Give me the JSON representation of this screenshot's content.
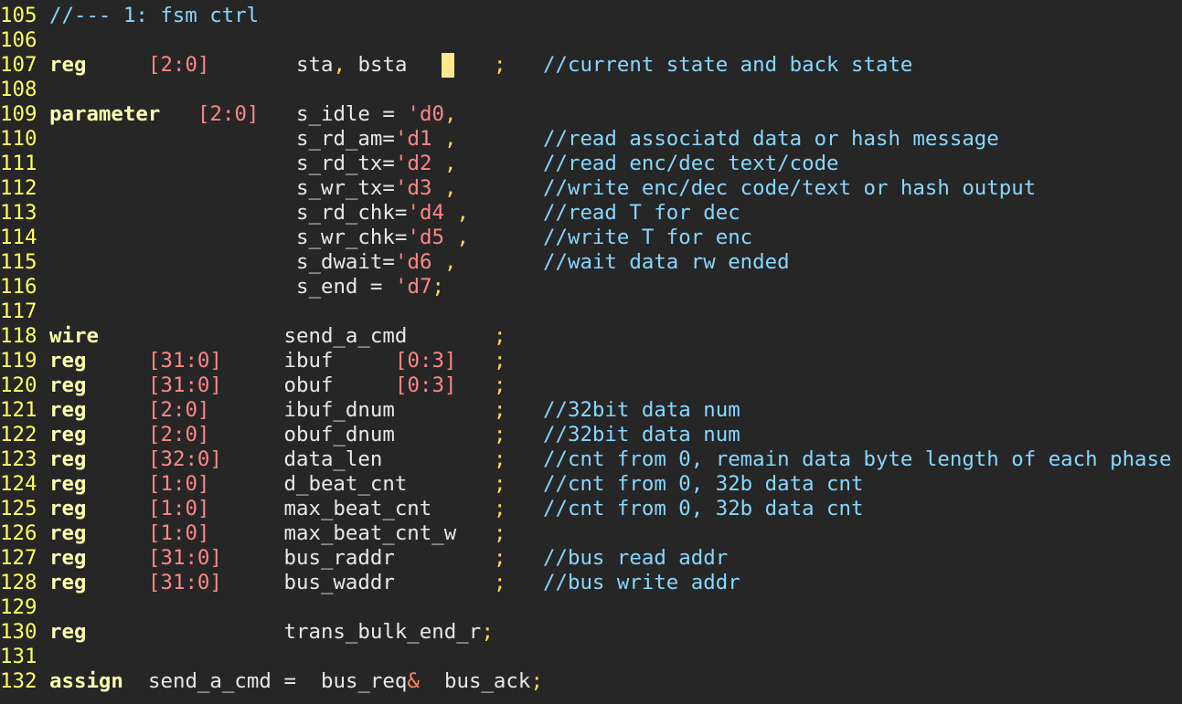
{
  "lines": [
    {
      "n": "105",
      "tokens": [
        {
          "cls": "cm",
          "text": "//--- 1: fsm ctrl"
        }
      ]
    },
    {
      "n": "106",
      "tokens": []
    },
    {
      "n": "107",
      "tokens": [
        {
          "cls": "kw",
          "text": "reg"
        },
        {
          "cls": "num",
          "text": "[2:0]"
        },
        {
          "cls": "id",
          "text": "sta"
        },
        {
          "cls": "pun",
          "text": ","
        },
        {
          "cls": "id",
          "text": "bsta"
        },
        {
          "cls": "pun",
          "text": ";"
        },
        {
          "cls": "cm",
          "text": "//current state and back state"
        }
      ]
    },
    {
      "n": "108",
      "tokens": []
    },
    {
      "n": "109",
      "tokens": [
        {
          "cls": "kw",
          "text": "parameter"
        },
        {
          "cls": "num",
          "text": "[2:0]"
        },
        {
          "cls": "id",
          "text": "s_idle ="
        },
        {
          "cls": "num",
          "text": "'d0"
        },
        {
          "cls": "pun",
          "text": ","
        }
      ]
    },
    {
      "n": "110",
      "tokens": [
        {
          "cls": "id",
          "text": "s_rd_am="
        },
        {
          "cls": "num",
          "text": "'d1"
        },
        {
          "cls": "pun",
          "text": ","
        },
        {
          "cls": "cm",
          "text": "//read associatd data or hash message"
        }
      ]
    },
    {
      "n": "111",
      "tokens": [
        {
          "cls": "id",
          "text": "s_rd_tx="
        },
        {
          "cls": "num",
          "text": "'d2"
        },
        {
          "cls": "pun",
          "text": ","
        },
        {
          "cls": "cm",
          "text": "//read enc/dec text/code"
        }
      ]
    },
    {
      "n": "112",
      "tokens": [
        {
          "cls": "id",
          "text": "s_wr_tx="
        },
        {
          "cls": "num",
          "text": "'d3"
        },
        {
          "cls": "pun",
          "text": ","
        },
        {
          "cls": "cm",
          "text": "//write enc/dec code/text or hash output"
        }
      ]
    },
    {
      "n": "113",
      "tokens": [
        {
          "cls": "id",
          "text": "s_rd_chk="
        },
        {
          "cls": "num",
          "text": "'d4"
        },
        {
          "cls": "pun",
          "text": ","
        },
        {
          "cls": "cm",
          "text": "//read T for dec"
        }
      ]
    },
    {
      "n": "114",
      "tokens": [
        {
          "cls": "id",
          "text": "s_wr_chk="
        },
        {
          "cls": "num",
          "text": "'d5"
        },
        {
          "cls": "pun",
          "text": ","
        },
        {
          "cls": "cm",
          "text": "//write T for enc"
        }
      ]
    },
    {
      "n": "115",
      "tokens": [
        {
          "cls": "id",
          "text": "s_dwait="
        },
        {
          "cls": "num",
          "text": "'d6"
        },
        {
          "cls": "pun",
          "text": ","
        },
        {
          "cls": "cm",
          "text": "//wait data rw ended"
        }
      ]
    },
    {
      "n": "116",
      "tokens": [
        {
          "cls": "id",
          "text": "s_end ="
        },
        {
          "cls": "num",
          "text": "'d7"
        },
        {
          "cls": "pun",
          "text": ";"
        }
      ]
    },
    {
      "n": "117",
      "tokens": []
    },
    {
      "n": "118",
      "tokens": [
        {
          "cls": "kw",
          "text": "wire"
        },
        {
          "cls": "id",
          "text": "send_a_cmd"
        },
        {
          "cls": "pun",
          "text": ";"
        }
      ]
    },
    {
      "n": "119",
      "tokens": [
        {
          "cls": "kw",
          "text": "reg"
        },
        {
          "cls": "num",
          "text": "[31:0]"
        },
        {
          "cls": "id",
          "text": "ibuf"
        },
        {
          "cls": "num",
          "text": "[0:3]"
        },
        {
          "cls": "pun",
          "text": ";"
        }
      ]
    },
    {
      "n": "120",
      "tokens": [
        {
          "cls": "kw",
          "text": "reg"
        },
        {
          "cls": "num",
          "text": "[31:0]"
        },
        {
          "cls": "id",
          "text": "obuf"
        },
        {
          "cls": "num",
          "text": "[0:3]"
        },
        {
          "cls": "pun",
          "text": ";"
        }
      ]
    },
    {
      "n": "121",
      "tokens": [
        {
          "cls": "kw",
          "text": "reg"
        },
        {
          "cls": "num",
          "text": "[2:0]"
        },
        {
          "cls": "id",
          "text": "ibuf_dnum"
        },
        {
          "cls": "pun",
          "text": ";"
        },
        {
          "cls": "cm",
          "text": "//32bit data num"
        }
      ]
    },
    {
      "n": "122",
      "tokens": [
        {
          "cls": "kw",
          "text": "reg"
        },
        {
          "cls": "num",
          "text": "[2:0]"
        },
        {
          "cls": "id",
          "text": "obuf_dnum"
        },
        {
          "cls": "pun",
          "text": ";"
        },
        {
          "cls": "cm",
          "text": "//32bit data num"
        }
      ]
    },
    {
      "n": "123",
      "tokens": [
        {
          "cls": "kw",
          "text": "reg"
        },
        {
          "cls": "num",
          "text": "[32:0]"
        },
        {
          "cls": "id",
          "text": "data_len"
        },
        {
          "cls": "pun",
          "text": ";"
        },
        {
          "cls": "cm",
          "text": "//cnt from 0, remain data byte length of each phase"
        }
      ]
    },
    {
      "n": "124",
      "tokens": [
        {
          "cls": "kw",
          "text": "reg"
        },
        {
          "cls": "num",
          "text": "[1:0]"
        },
        {
          "cls": "id",
          "text": "d_beat_cnt"
        },
        {
          "cls": "pun",
          "text": ";"
        },
        {
          "cls": "cm",
          "text": "//cnt from 0, 32b data cnt"
        }
      ]
    },
    {
      "n": "125",
      "tokens": [
        {
          "cls": "kw",
          "text": "reg"
        },
        {
          "cls": "num",
          "text": "[1:0]"
        },
        {
          "cls": "id",
          "text": "max_beat_cnt"
        },
        {
          "cls": "pun",
          "text": ";"
        },
        {
          "cls": "cm",
          "text": "//cnt from 0, 32b data cnt"
        }
      ]
    },
    {
      "n": "126",
      "tokens": [
        {
          "cls": "kw",
          "text": "reg"
        },
        {
          "cls": "num",
          "text": "[1:0]"
        },
        {
          "cls": "id",
          "text": "max_beat_cnt_w"
        },
        {
          "cls": "pun",
          "text": ";"
        }
      ]
    },
    {
      "n": "127",
      "tokens": [
        {
          "cls": "kw",
          "text": "reg"
        },
        {
          "cls": "num",
          "text": "[31:0]"
        },
        {
          "cls": "id",
          "text": "bus_raddr"
        },
        {
          "cls": "pun",
          "text": ";"
        },
        {
          "cls": "cm",
          "text": "//bus read addr"
        }
      ]
    },
    {
      "n": "128",
      "tokens": [
        {
          "cls": "kw",
          "text": "reg"
        },
        {
          "cls": "num",
          "text": "[31:0]"
        },
        {
          "cls": "id",
          "text": "bus_waddr"
        },
        {
          "cls": "pun",
          "text": ";"
        },
        {
          "cls": "cm",
          "text": "//bus write addr"
        }
      ]
    },
    {
      "n": "129",
      "tokens": []
    },
    {
      "n": "130",
      "tokens": [
        {
          "cls": "kw",
          "text": "reg"
        },
        {
          "cls": "id",
          "text": "trans_bulk_end_r"
        },
        {
          "cls": "pun",
          "text": ";"
        }
      ]
    },
    {
      "n": "131",
      "tokens": []
    },
    {
      "n": "132",
      "tokens": [
        {
          "cls": "kw",
          "text": "assign"
        },
        {
          "cls": "id",
          "text": "send_a_cmd"
        },
        {
          "cls": "id",
          "text": "="
        },
        {
          "cls": "id",
          "text": "bus_req"
        },
        {
          "cls": "op",
          "text": "&"
        },
        {
          "cls": "id",
          "text": "bus_ack"
        },
        {
          "cls": "pun",
          "text": ";"
        }
      ]
    }
  ]
}
